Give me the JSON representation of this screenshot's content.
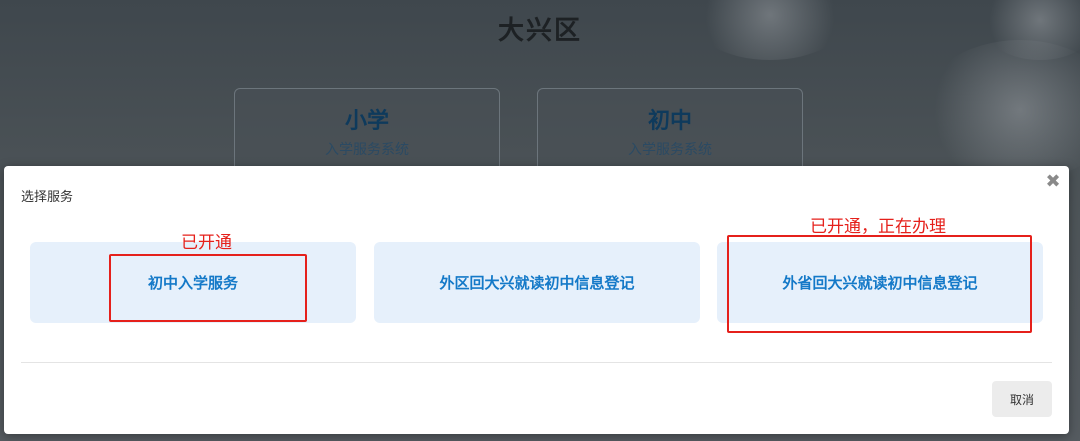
{
  "background": {
    "region_title": "大兴区",
    "level_cards": [
      {
        "title": "小学",
        "subtitle": "入学服务系统"
      },
      {
        "title": "初中",
        "subtitle": "入学服务系统"
      }
    ]
  },
  "modal": {
    "title": "选择服务",
    "close_icon": "close-icon",
    "services": [
      {
        "label": "初中入学服务"
      },
      {
        "label": "外区回大兴就读初中信息登记"
      },
      {
        "label": "外省回大兴就读初中信息登记"
      }
    ],
    "annotations": [
      {
        "text": "已开通"
      },
      {
        "text": "已开通，正在办理"
      }
    ],
    "cancel_label": "取消"
  },
  "colors": {
    "accent": "#1479c8",
    "service_bg": "#e6f0fb",
    "annotation_red": "#e5201b"
  }
}
